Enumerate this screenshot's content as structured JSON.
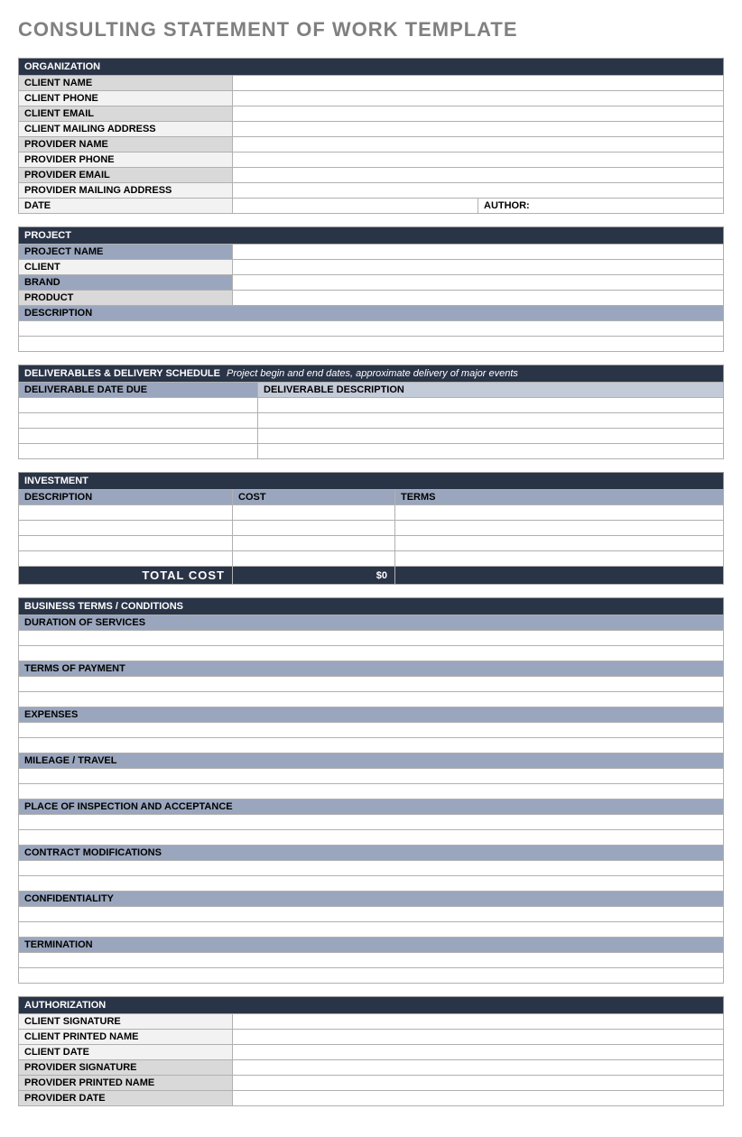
{
  "title": "CONSULTING STATEMENT OF WORK TEMPLATE",
  "organization": {
    "header": "ORGANIZATION",
    "rows": [
      {
        "label": "CLIENT NAME",
        "bg": "bg-gray-med"
      },
      {
        "label": "CLIENT  PHONE",
        "bg": "bg-gray-light"
      },
      {
        "label": "CLIENT EMAIL",
        "bg": "bg-gray-med"
      },
      {
        "label": "CLIENT MAILING ADDRESS",
        "bg": "bg-gray-light"
      },
      {
        "label": "PROVIDER NAME",
        "bg": "bg-gray-med"
      },
      {
        "label": "PROVIDER PHONE",
        "bg": "bg-gray-light"
      },
      {
        "label": "PROVIDER EMAIL",
        "bg": "bg-gray-med"
      },
      {
        "label": "PROVIDER MAILING ADDRESS",
        "bg": "bg-gray-light"
      }
    ],
    "date_label": "DATE",
    "author_label": "AUTHOR:"
  },
  "project": {
    "header": "PROJECT",
    "rows": [
      {
        "label": "PROJECT NAME",
        "bg": "bg-blue-gray"
      },
      {
        "label": "CLIENT",
        "bg": "bg-gray-light"
      },
      {
        "label": "BRAND",
        "bg": "bg-blue-gray"
      },
      {
        "label": "PRODUCT",
        "bg": "bg-gray-med"
      }
    ],
    "description_label": "DESCRIPTION"
  },
  "deliverables": {
    "header": "DELIVERABLES & DELIVERY SCHEDULE",
    "subtitle": "Project begin and end dates, approximate delivery of major events",
    "col1": "DELIVERABLE DATE DUE",
    "col2": "DELIVERABLE DESCRIPTION"
  },
  "investment": {
    "header": "INVESTMENT",
    "col1": "DESCRIPTION",
    "col2": "COST",
    "col3": "TERMS",
    "total_label": "TOTAL COST",
    "total_value": "$0"
  },
  "terms": {
    "header": "BUSINESS TERMS / CONDITIONS",
    "items": [
      "DURATION OF SERVICES",
      "TERMS OF PAYMENT",
      "EXPENSES",
      "MILEAGE / TRAVEL",
      "PLACE OF INSPECTION AND ACCEPTANCE",
      "CONTRACT MODIFICATIONS",
      "CONFIDENTIALITY",
      "TERMINATION"
    ]
  },
  "authorization": {
    "header": "AUTHORIZATION",
    "rows": [
      {
        "label": "CLIENT SIGNATURE",
        "bg": "bg-gray-light"
      },
      {
        "label": "CLIENT PRINTED NAME",
        "bg": "bg-gray-light"
      },
      {
        "label": "CLIENT DATE",
        "bg": "bg-gray-light"
      },
      {
        "label": "PROVIDER SIGNATURE",
        "bg": "bg-gray-med"
      },
      {
        "label": "PROVIDER PRINTED NAME",
        "bg": "bg-gray-med"
      },
      {
        "label": "PROVIDER DATE",
        "bg": "bg-gray-med"
      }
    ]
  }
}
